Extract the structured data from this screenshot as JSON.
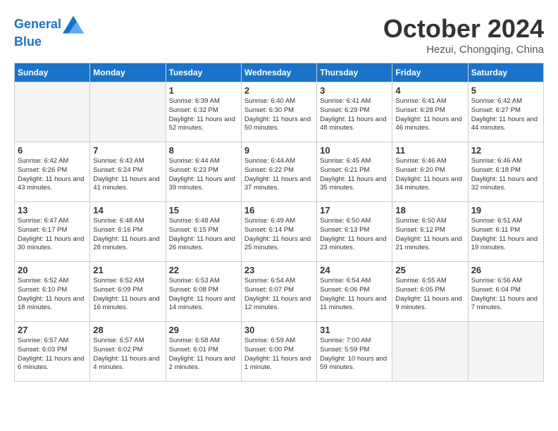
{
  "header": {
    "logo_line1": "General",
    "logo_line2": "Blue",
    "month_title": "October 2024",
    "location": "Hezui, Chongqing, China"
  },
  "weekdays": [
    "Sunday",
    "Monday",
    "Tuesday",
    "Wednesday",
    "Thursday",
    "Friday",
    "Saturday"
  ],
  "weeks": [
    [
      {
        "day": "",
        "empty": true
      },
      {
        "day": "",
        "empty": true
      },
      {
        "day": "1",
        "sunrise": "Sunrise: 6:39 AM",
        "sunset": "Sunset: 6:32 PM",
        "daylight": "Daylight: 11 hours and 52 minutes."
      },
      {
        "day": "2",
        "sunrise": "Sunrise: 6:40 AM",
        "sunset": "Sunset: 6:30 PM",
        "daylight": "Daylight: 11 hours and 50 minutes."
      },
      {
        "day": "3",
        "sunrise": "Sunrise: 6:41 AM",
        "sunset": "Sunset: 6:29 PM",
        "daylight": "Daylight: 11 hours and 48 minutes."
      },
      {
        "day": "4",
        "sunrise": "Sunrise: 6:41 AM",
        "sunset": "Sunset: 6:28 PM",
        "daylight": "Daylight: 11 hours and 46 minutes."
      },
      {
        "day": "5",
        "sunrise": "Sunrise: 6:42 AM",
        "sunset": "Sunset: 6:27 PM",
        "daylight": "Daylight: 11 hours and 44 minutes."
      }
    ],
    [
      {
        "day": "6",
        "sunrise": "Sunrise: 6:42 AM",
        "sunset": "Sunset: 6:26 PM",
        "daylight": "Daylight: 11 hours and 43 minutes."
      },
      {
        "day": "7",
        "sunrise": "Sunrise: 6:43 AM",
        "sunset": "Sunset: 6:24 PM",
        "daylight": "Daylight: 11 hours and 41 minutes."
      },
      {
        "day": "8",
        "sunrise": "Sunrise: 6:44 AM",
        "sunset": "Sunset: 6:23 PM",
        "daylight": "Daylight: 11 hours and 39 minutes."
      },
      {
        "day": "9",
        "sunrise": "Sunrise: 6:44 AM",
        "sunset": "Sunset: 6:22 PM",
        "daylight": "Daylight: 11 hours and 37 minutes."
      },
      {
        "day": "10",
        "sunrise": "Sunrise: 6:45 AM",
        "sunset": "Sunset: 6:21 PM",
        "daylight": "Daylight: 11 hours and 35 minutes."
      },
      {
        "day": "11",
        "sunrise": "Sunrise: 6:46 AM",
        "sunset": "Sunset: 6:20 PM",
        "daylight": "Daylight: 11 hours and 34 minutes."
      },
      {
        "day": "12",
        "sunrise": "Sunrise: 6:46 AM",
        "sunset": "Sunset: 6:18 PM",
        "daylight": "Daylight: 11 hours and 32 minutes."
      }
    ],
    [
      {
        "day": "13",
        "sunrise": "Sunrise: 6:47 AM",
        "sunset": "Sunset: 6:17 PM",
        "daylight": "Daylight: 11 hours and 30 minutes."
      },
      {
        "day": "14",
        "sunrise": "Sunrise: 6:48 AM",
        "sunset": "Sunset: 6:16 PM",
        "daylight": "Daylight: 11 hours and 28 minutes."
      },
      {
        "day": "15",
        "sunrise": "Sunrise: 6:48 AM",
        "sunset": "Sunset: 6:15 PM",
        "daylight": "Daylight: 11 hours and 26 minutes."
      },
      {
        "day": "16",
        "sunrise": "Sunrise: 6:49 AM",
        "sunset": "Sunset: 6:14 PM",
        "daylight": "Daylight: 11 hours and 25 minutes."
      },
      {
        "day": "17",
        "sunrise": "Sunrise: 6:50 AM",
        "sunset": "Sunset: 6:13 PM",
        "daylight": "Daylight: 11 hours and 23 minutes."
      },
      {
        "day": "18",
        "sunrise": "Sunrise: 6:50 AM",
        "sunset": "Sunset: 6:12 PM",
        "daylight": "Daylight: 11 hours and 21 minutes."
      },
      {
        "day": "19",
        "sunrise": "Sunrise: 6:51 AM",
        "sunset": "Sunset: 6:11 PM",
        "daylight": "Daylight: 11 hours and 19 minutes."
      }
    ],
    [
      {
        "day": "20",
        "sunrise": "Sunrise: 6:52 AM",
        "sunset": "Sunset: 6:10 PM",
        "daylight": "Daylight: 11 hours and 18 minutes."
      },
      {
        "day": "21",
        "sunrise": "Sunrise: 6:52 AM",
        "sunset": "Sunset: 6:09 PM",
        "daylight": "Daylight: 11 hours and 16 minutes."
      },
      {
        "day": "22",
        "sunrise": "Sunrise: 6:53 AM",
        "sunset": "Sunset: 6:08 PM",
        "daylight": "Daylight: 11 hours and 14 minutes."
      },
      {
        "day": "23",
        "sunrise": "Sunrise: 6:54 AM",
        "sunset": "Sunset: 6:07 PM",
        "daylight": "Daylight: 11 hours and 12 minutes."
      },
      {
        "day": "24",
        "sunrise": "Sunrise: 6:54 AM",
        "sunset": "Sunset: 6:06 PM",
        "daylight": "Daylight: 11 hours and 11 minutes."
      },
      {
        "day": "25",
        "sunrise": "Sunrise: 6:55 AM",
        "sunset": "Sunset: 6:05 PM",
        "daylight": "Daylight: 11 hours and 9 minutes."
      },
      {
        "day": "26",
        "sunrise": "Sunrise: 6:56 AM",
        "sunset": "Sunset: 6:04 PM",
        "daylight": "Daylight: 11 hours and 7 minutes."
      }
    ],
    [
      {
        "day": "27",
        "sunrise": "Sunrise: 6:57 AM",
        "sunset": "Sunset: 6:03 PM",
        "daylight": "Daylight: 11 hours and 6 minutes."
      },
      {
        "day": "28",
        "sunrise": "Sunrise: 6:57 AM",
        "sunset": "Sunset: 6:02 PM",
        "daylight": "Daylight: 11 hours and 4 minutes."
      },
      {
        "day": "29",
        "sunrise": "Sunrise: 6:58 AM",
        "sunset": "Sunset: 6:01 PM",
        "daylight": "Daylight: 11 hours and 2 minutes."
      },
      {
        "day": "30",
        "sunrise": "Sunrise: 6:59 AM",
        "sunset": "Sunset: 6:00 PM",
        "daylight": "Daylight: 11 hours and 1 minute."
      },
      {
        "day": "31",
        "sunrise": "Sunrise: 7:00 AM",
        "sunset": "Sunset: 5:59 PM",
        "daylight": "Daylight: 10 hours and 59 minutes."
      },
      {
        "day": "",
        "empty": true
      },
      {
        "day": "",
        "empty": true
      }
    ]
  ]
}
